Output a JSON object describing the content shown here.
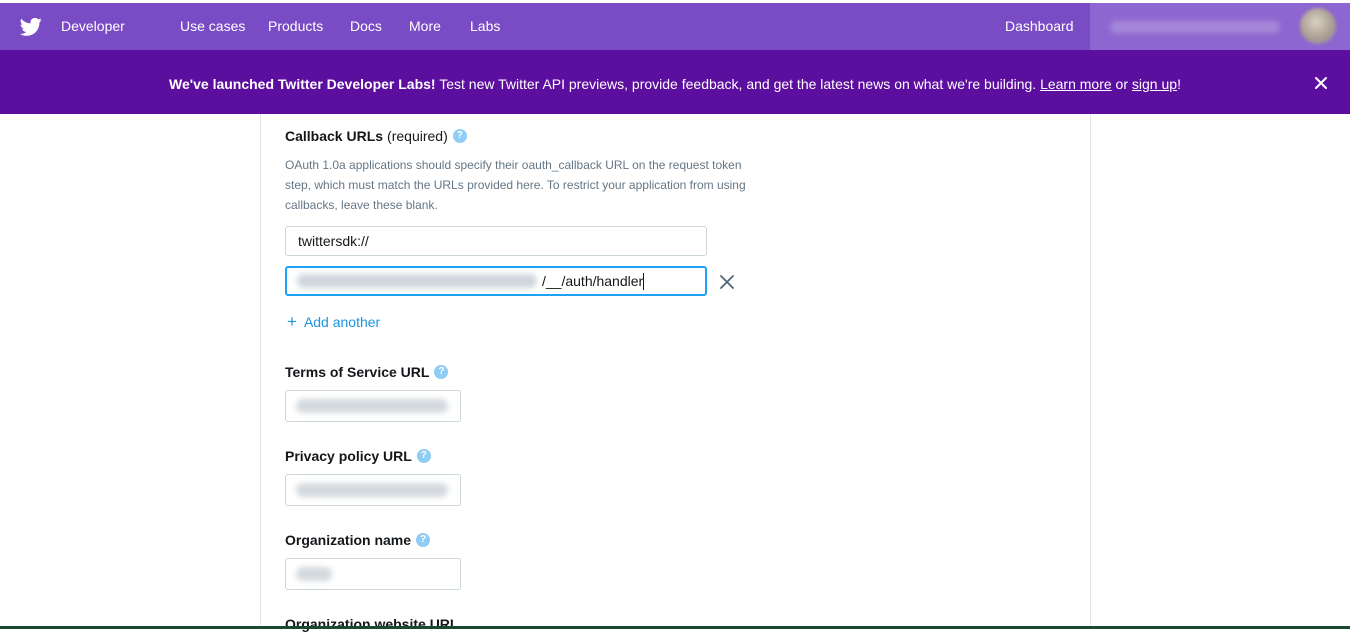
{
  "nav": {
    "brand": "Developer",
    "links": [
      "Use cases",
      "Products",
      "Docs",
      "More",
      "Labs"
    ],
    "dashboard": "Dashboard",
    "logo_icon": "twitter-bird-icon"
  },
  "banner": {
    "bold": "We've launched Twitter Developer Labs!",
    "text": " Test new Twitter API previews, provide feedback, and get the latest news on what we're building. ",
    "learn_more": "Learn more",
    "or": " or ",
    "sign_up": "sign up",
    "end": "!",
    "close_icon": "close-icon"
  },
  "form": {
    "callback": {
      "label": "Callback URLs",
      "required": "(required)",
      "description": "OAuth 1.0a applications should specify their oauth_callback URL on the request token step, which must match the URLs provided here. To restrict your application from using callbacks, leave these blank.",
      "urls": [
        "twittersdk://",
        "/__/auth/handler"
      ],
      "add_another": "Add another"
    },
    "tos_label": "Terms of Service URL",
    "privacy_label": "Privacy policy URL",
    "org_name_label": "Organization name",
    "org_website_label": "Organization website URL"
  },
  "colors": {
    "nav_bg": "#794bc4",
    "banner_bg": "#5c0e9e",
    "link": "#1b95e0",
    "help": "#8fcdf5"
  }
}
